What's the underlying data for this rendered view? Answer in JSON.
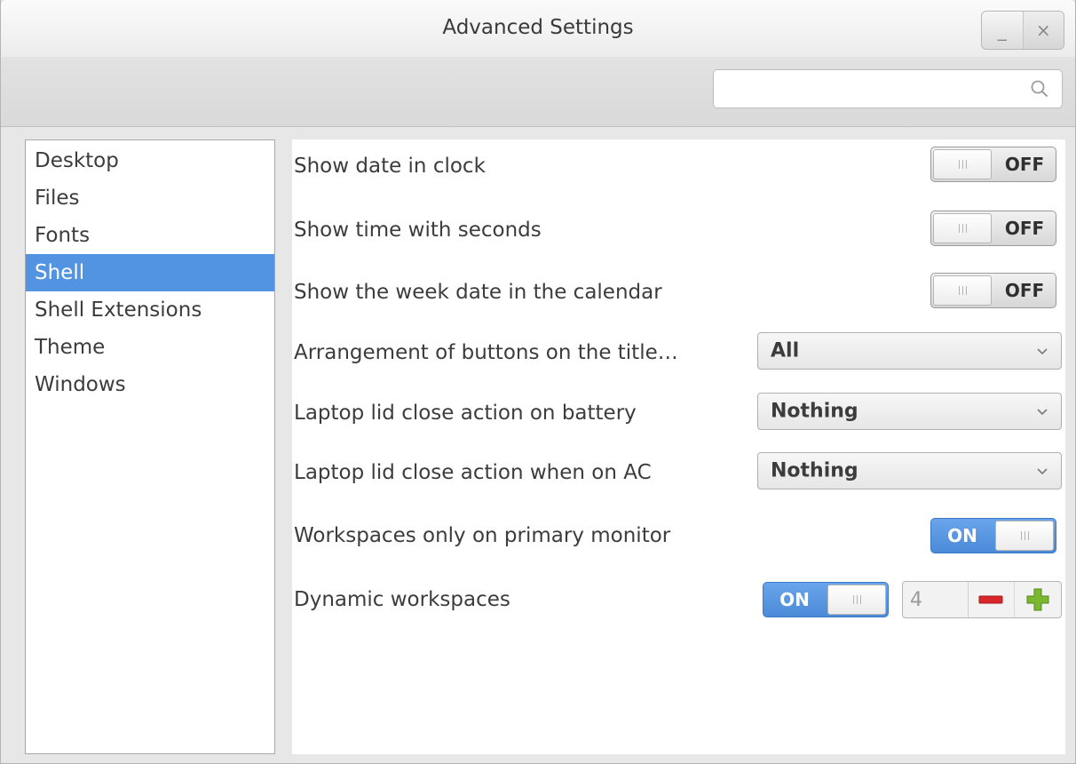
{
  "window": {
    "title": "Advanced Settings",
    "minimize_label": "_",
    "close_label": "×"
  },
  "search": {
    "value": "",
    "placeholder": "",
    "icon": "search-icon"
  },
  "sidebar": {
    "items": [
      {
        "label": "Desktop",
        "selected": false
      },
      {
        "label": "Files",
        "selected": false
      },
      {
        "label": "Fonts",
        "selected": false
      },
      {
        "label": "Shell",
        "selected": true
      },
      {
        "label": "Shell Extensions",
        "selected": false
      },
      {
        "label": "Theme",
        "selected": false
      },
      {
        "label": "Windows",
        "selected": false
      }
    ]
  },
  "settings": {
    "show_date": {
      "label": "Show date in clock",
      "state": "OFF"
    },
    "show_seconds": {
      "label": "Show time with seconds",
      "state": "OFF"
    },
    "week_date": {
      "label": "Show the week date in the calendar",
      "state": "OFF"
    },
    "button_arrangement": {
      "label": "Arrangement of buttons on the title…",
      "value": "All"
    },
    "lid_battery": {
      "label": "Laptop lid close action on battery",
      "value": "Nothing"
    },
    "lid_ac": {
      "label": "Laptop lid close action when on AC",
      "value": "Nothing"
    },
    "workspaces_primary": {
      "label": "Workspaces only on primary monitor",
      "state": "ON"
    },
    "dynamic_workspaces": {
      "label": "Dynamic workspaces",
      "state": "ON",
      "count": "4"
    }
  },
  "colors": {
    "accent": "#5294e2",
    "minus": "#d9262a",
    "plus": "#7cb82f"
  }
}
